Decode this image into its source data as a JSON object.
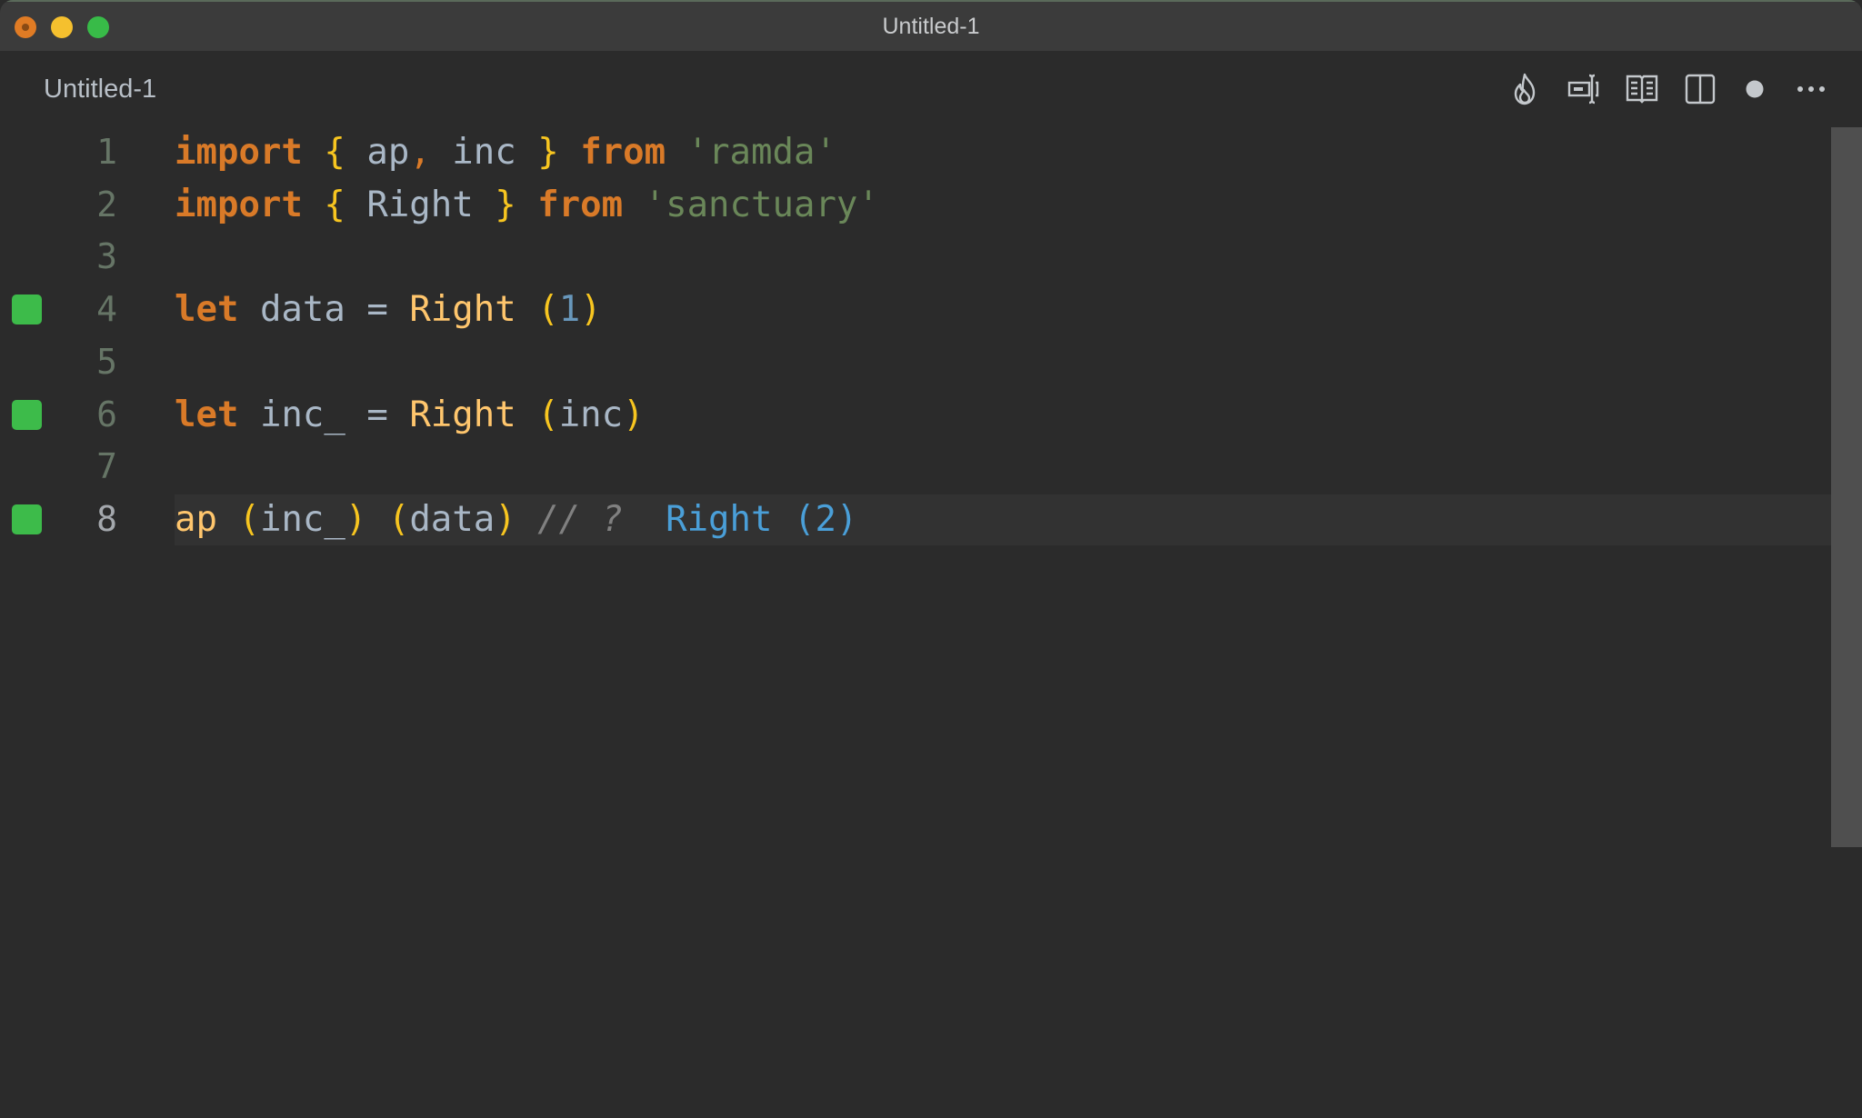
{
  "window": {
    "title": "Untitled-1",
    "traffic_lights": [
      "close",
      "minimize",
      "maximize"
    ]
  },
  "tab": {
    "label": "Untitled-1"
  },
  "toolbar": {
    "actions": [
      {
        "icon": "flame-icon",
        "label": "Quokka"
      },
      {
        "icon": "rename-cursor-icon",
        "label": "Editor action"
      },
      {
        "icon": "open-book-icon",
        "label": "Open preview"
      },
      {
        "icon": "split-editor-icon",
        "label": "Split editor"
      },
      {
        "icon": "unsaved-dot-icon",
        "label": "Unsaved changes"
      },
      {
        "icon": "more-icon",
        "label": "More actions"
      }
    ]
  },
  "colors": {
    "keyword": "#d97a28",
    "brace": "#f7c520",
    "identifier": "#a9b7c6",
    "string": "#6a8759",
    "function": "#ffc66d",
    "number": "#6897bb",
    "comment": "#808080",
    "result": "#4a9fd8",
    "marker": "#3dbb4a"
  },
  "editor": {
    "current_line": 8,
    "lines": [
      {
        "n": "1",
        "marker": false,
        "tokens": [
          {
            "t": "kw",
            "v": "import"
          },
          {
            "t": "sp",
            "v": " "
          },
          {
            "t": "br",
            "v": "{"
          },
          {
            "t": "sp",
            "v": " "
          },
          {
            "t": "id",
            "v": "ap"
          },
          {
            "t": "pun",
            "v": ","
          },
          {
            "t": "sp",
            "v": " "
          },
          {
            "t": "id",
            "v": "inc"
          },
          {
            "t": "sp",
            "v": " "
          },
          {
            "t": "br",
            "v": "}"
          },
          {
            "t": "sp",
            "v": " "
          },
          {
            "t": "kw",
            "v": "from"
          },
          {
            "t": "sp",
            "v": " "
          },
          {
            "t": "str",
            "v": "'ramda'"
          }
        ]
      },
      {
        "n": "2",
        "marker": false,
        "tokens": [
          {
            "t": "kw",
            "v": "import"
          },
          {
            "t": "sp",
            "v": " "
          },
          {
            "t": "br",
            "v": "{"
          },
          {
            "t": "sp",
            "v": " "
          },
          {
            "t": "id",
            "v": "Right"
          },
          {
            "t": "sp",
            "v": " "
          },
          {
            "t": "br",
            "v": "}"
          },
          {
            "t": "sp",
            "v": " "
          },
          {
            "t": "kw",
            "v": "from"
          },
          {
            "t": "sp",
            "v": " "
          },
          {
            "t": "str",
            "v": "'sanctuary'"
          }
        ]
      },
      {
        "n": "3",
        "marker": false,
        "tokens": []
      },
      {
        "n": "4",
        "marker": true,
        "tokens": [
          {
            "t": "kw",
            "v": "let"
          },
          {
            "t": "sp",
            "v": " "
          },
          {
            "t": "id",
            "v": "data"
          },
          {
            "t": "sp",
            "v": " "
          },
          {
            "t": "op",
            "v": "="
          },
          {
            "t": "sp",
            "v": " "
          },
          {
            "t": "fn",
            "v": "Right"
          },
          {
            "t": "sp",
            "v": " "
          },
          {
            "t": "br",
            "v": "("
          },
          {
            "t": "num",
            "v": "1"
          },
          {
            "t": "br",
            "v": ")"
          }
        ]
      },
      {
        "n": "5",
        "marker": false,
        "tokens": []
      },
      {
        "n": "6",
        "marker": true,
        "tokens": [
          {
            "t": "kw",
            "v": "let"
          },
          {
            "t": "sp",
            "v": " "
          },
          {
            "t": "id",
            "v": "inc_"
          },
          {
            "t": "sp",
            "v": " "
          },
          {
            "t": "op",
            "v": "="
          },
          {
            "t": "sp",
            "v": " "
          },
          {
            "t": "fn",
            "v": "Right"
          },
          {
            "t": "sp",
            "v": " "
          },
          {
            "t": "br",
            "v": "("
          },
          {
            "t": "id",
            "v": "inc"
          },
          {
            "t": "br",
            "v": ")"
          }
        ]
      },
      {
        "n": "7",
        "marker": false,
        "tokens": []
      },
      {
        "n": "8",
        "marker": true,
        "tokens": [
          {
            "t": "fn",
            "v": "ap"
          },
          {
            "t": "sp",
            "v": " "
          },
          {
            "t": "br",
            "v": "("
          },
          {
            "t": "id",
            "v": "inc_"
          },
          {
            "t": "br",
            "v": ")"
          },
          {
            "t": "sp",
            "v": " "
          },
          {
            "t": "br",
            "v": "("
          },
          {
            "t": "id",
            "v": "data"
          },
          {
            "t": "br",
            "v": ")"
          },
          {
            "t": "sp",
            "v": " "
          },
          {
            "t": "cm",
            "v": "// ?"
          },
          {
            "t": "sp",
            "v": "  "
          },
          {
            "t": "res",
            "v": "Right (2)"
          }
        ]
      }
    ]
  }
}
